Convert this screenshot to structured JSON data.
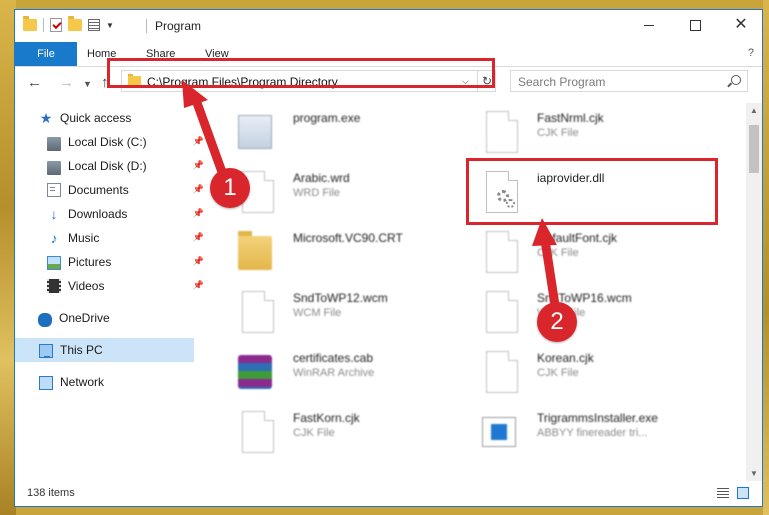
{
  "window": {
    "title": "Program",
    "controls": {
      "minimize": "—",
      "maximize": "☐",
      "close": "✕"
    }
  },
  "ribbon": {
    "tabs": [
      "File",
      "Home",
      "Share",
      "View"
    ],
    "help": "?"
  },
  "address_bar": {
    "path": "C:\\Program Files\\Program Directory",
    "refresh_glyph": "↻"
  },
  "search": {
    "placeholder": "Search Program"
  },
  "nav_pane": {
    "items": [
      {
        "label": "Quick access",
        "icon": "star-icon"
      },
      {
        "label": "Local Disk (C:)",
        "icon": "drive-icon",
        "pinned": true
      },
      {
        "label": "Local Disk (D:)",
        "icon": "drive-icon",
        "pinned": true
      },
      {
        "label": "Documents",
        "icon": "documents-icon",
        "pinned": true
      },
      {
        "label": "Downloads",
        "icon": "download-icon",
        "pinned": true
      },
      {
        "label": "Music",
        "icon": "music-icon",
        "pinned": true
      },
      {
        "label": "Pictures",
        "icon": "pictures-icon",
        "pinned": true
      },
      {
        "label": "Videos",
        "icon": "videos-icon",
        "pinned": true
      },
      {
        "label": "OneDrive",
        "icon": "cloud-icon"
      },
      {
        "label": "This PC",
        "icon": "computer-icon",
        "selected": true
      },
      {
        "label": "Network",
        "icon": "network-icon"
      }
    ]
  },
  "files": [
    {
      "name": "program.exe",
      "type": "",
      "icon": "exe-icon"
    },
    {
      "name": "FastNrml.cjk",
      "type": "CJK File",
      "icon": "file-icon"
    },
    {
      "name": "Arabic.wrd",
      "type": "WRD File",
      "icon": "file-icon"
    },
    {
      "name": "iaprovider.dll",
      "type": "",
      "icon": "dll-gear-icon"
    },
    {
      "name": "Microsoft.VC90.CRT",
      "type": "",
      "icon": "folder-icon"
    },
    {
      "name": "DefaultFont.cjk",
      "type": "CJK File",
      "icon": "file-icon"
    },
    {
      "name": "SndToWP12.wcm",
      "type": "WCM File",
      "icon": "file-icon"
    },
    {
      "name": "SndToWP16.wcm",
      "type": "WCM File",
      "icon": "file-icon"
    },
    {
      "name": "certificates.cab",
      "type": "WinRAR Archive",
      "icon": "winrar-icon"
    },
    {
      "name": "Korean.cjk",
      "type": "CJK File",
      "icon": "file-icon"
    },
    {
      "name": "FastKorn.cjk",
      "type": "CJK File",
      "icon": "file-icon"
    },
    {
      "name": "TrigrammsInstaller.exe",
      "type": "ABBYY finereader tri...",
      "icon": "installer-icon"
    }
  ],
  "status": {
    "items_count": "138 items"
  },
  "annotations": {
    "step1": "1",
    "step2": "2",
    "accent": "#d9262c"
  }
}
